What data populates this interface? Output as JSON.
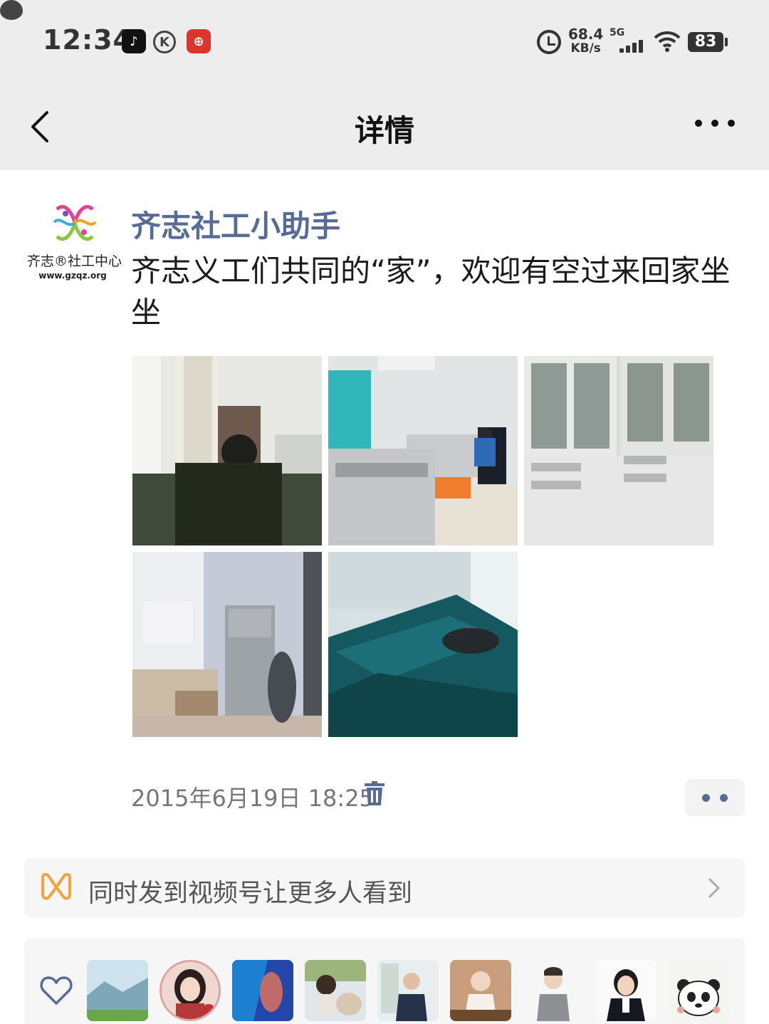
{
  "status_bar": {
    "time": "12:34",
    "speed_value": "68.4",
    "speed_unit": "KB/s",
    "network": "5G",
    "battery": "83",
    "icons": [
      "tiktok-icon",
      "k-icon",
      "bank-icon",
      "chat-icon",
      "alarm-icon",
      "signal-icon",
      "wifi-icon",
      "battery-icon"
    ]
  },
  "nav": {
    "title": "详情",
    "back_icon": "chevron-left-icon",
    "more_icon": "more-dots-icon"
  },
  "post": {
    "avatar_text": "齐志®社工中心",
    "avatar_url": "www.gzqz.org",
    "author": "齐志社工小助手",
    "text": "齐志义工们共同的“家”，欢迎有空过来回家坐坐",
    "photos": [
      "photo-man-at-desk",
      "photo-office-printer",
      "photo-white-cabinets",
      "photo-fridge-cabinet",
      "photo-green-sofa"
    ],
    "time": "2015年6月19日 18:25"
  },
  "channels": {
    "text": "同时发到视频号让更多人看到",
    "icon": "channels-icon"
  },
  "likes": {
    "icon": "heart-icon",
    "avatars": [
      "liker-landscape",
      "liker-woman-red",
      "liker-poster",
      "liker-child",
      "liker-man-suit",
      "liker-woman-tea",
      "liker-man-grey",
      "liker-woman-dark",
      "liker-panda"
    ]
  },
  "colors": {
    "link_blue": "#576b95",
    "header_bg": "#ededed",
    "channels_orange": "#f4a23b"
  }
}
